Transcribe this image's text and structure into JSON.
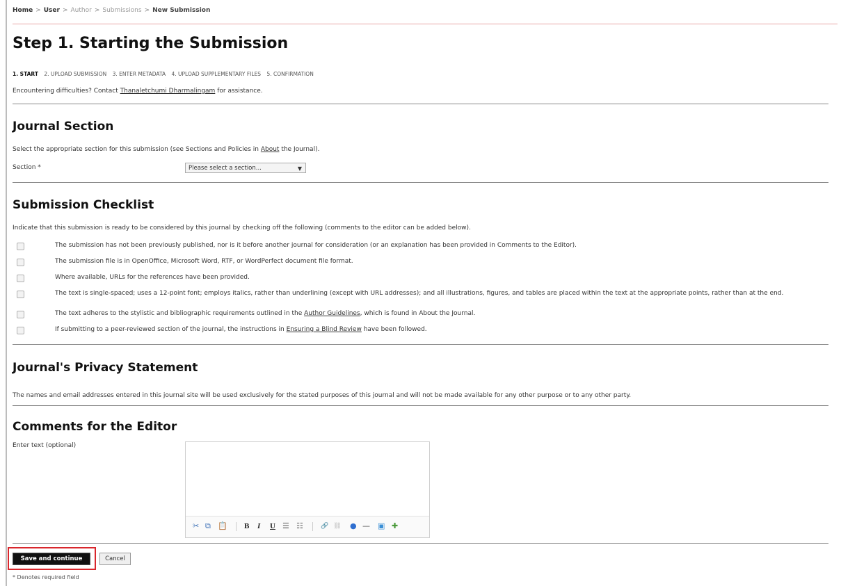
{
  "breadcrumb": {
    "home": "Home",
    "user": "User",
    "author": "Author",
    "submissions": "Submissions",
    "current": "New Submission",
    "separator": ">"
  },
  "page_title": "Step 1. Starting the Submission",
  "steps": [
    "1. START",
    "2. UPLOAD SUBMISSION",
    "3. ENTER METADATA",
    "4. UPLOAD SUPPLEMENTARY FILES",
    "5. CONFIRMATION"
  ],
  "help": {
    "prefix": "Encountering difficulties? Contact",
    "contact_name": "Thanaletchumi Dharmalingam",
    "suffix": "for assistance."
  },
  "journal_section": {
    "heading": "Journal Section",
    "instruction_prefix": "Select the appropriate section for this submission (see Sections and Policies in",
    "about_link": "About",
    "instruction_suffix": "the Journal).",
    "section_label": "Section *",
    "section_select_value": "Please select a section...",
    "dropdown_arrow": "▼"
  },
  "checklist": {
    "heading": "Submission Checklist",
    "intro": "Indicate that this submission is ready to be considered by this journal by checking off the following (comments to the editor can be added below).",
    "items": [
      {
        "text": "The submission has not been previously published, nor is it before another journal for consideration (or an explanation has been provided in Comments to the Editor)."
      },
      {
        "text": "The submission file is in OpenOffice, Microsoft Word, RTF, or WordPerfect document file format."
      },
      {
        "text": "Where available, URLs for the references have been provided."
      },
      {
        "text": "The text is single-spaced; uses a 12-point font; employs italics, rather than underlining (except with URL addresses); and all illustrations, figures, and tables are placed within the text at the appropriate points, rather than at the end."
      },
      {
        "text_before": "The text adheres to the stylistic and bibliographic requirements outlined in the",
        "link": "Author Guidelines",
        "text_after": ", which is found in About the Journal."
      },
      {
        "text_before": "If submitting to a peer-reviewed section of the journal, the instructions in",
        "link": "Ensuring a Blind Review",
        "text_after": "have been followed."
      }
    ]
  },
  "privacy": {
    "heading": "Journal's Privacy Statement",
    "text": "The names and email addresses entered in this journal site will be used exclusively for the stated purposes of this journal and will not be made available for any other purpose or to any other party."
  },
  "comments": {
    "heading": "Comments for the Editor",
    "label": "Enter text (optional)",
    "value": ""
  },
  "editor_toolbar": [
    {
      "name": "cut-icon",
      "glyph": "✂",
      "color": "#3b6fb6"
    },
    {
      "name": "copy-icon",
      "glyph": "⧉",
      "color": "#3b6fb6"
    },
    {
      "name": "paste-icon",
      "glyph": "📋",
      "color": "#c99a2e"
    },
    {
      "name": "bold-icon",
      "glyph": "B",
      "color": "#222222"
    },
    {
      "name": "italic-icon",
      "glyph": "I",
      "color": "#222222"
    },
    {
      "name": "underline-icon",
      "glyph": "U",
      "color": "#222222"
    },
    {
      "name": "bullet-list-icon",
      "glyph": "☰",
      "color": "#555555"
    },
    {
      "name": "numbered-list-icon",
      "glyph": "☷",
      "color": "#555555"
    },
    {
      "name": "link-icon",
      "glyph": "🔗",
      "color": "#b5b5b5"
    },
    {
      "name": "unlink-icon",
      "glyph": "⛓",
      "color": "#b5b5b5"
    },
    {
      "name": "anchor-icon",
      "glyph": "●",
      "color": "#2f6fd0"
    },
    {
      "name": "horizontal-rule-icon",
      "glyph": "—",
      "color": "#555555"
    },
    {
      "name": "image-icon",
      "glyph": "▣",
      "color": "#3a8fd6"
    },
    {
      "name": "upload-icon",
      "glyph": "✚",
      "color": "#4a9a3a"
    }
  ],
  "actions": {
    "save_label": "Save and continue",
    "cancel_label": "Cancel"
  },
  "required_note": "* Denotes required field",
  "colors": {
    "highlight": "#d9262c",
    "save_button_bg": "#111111",
    "breadcrumb_rule": "#e9a6a6"
  }
}
